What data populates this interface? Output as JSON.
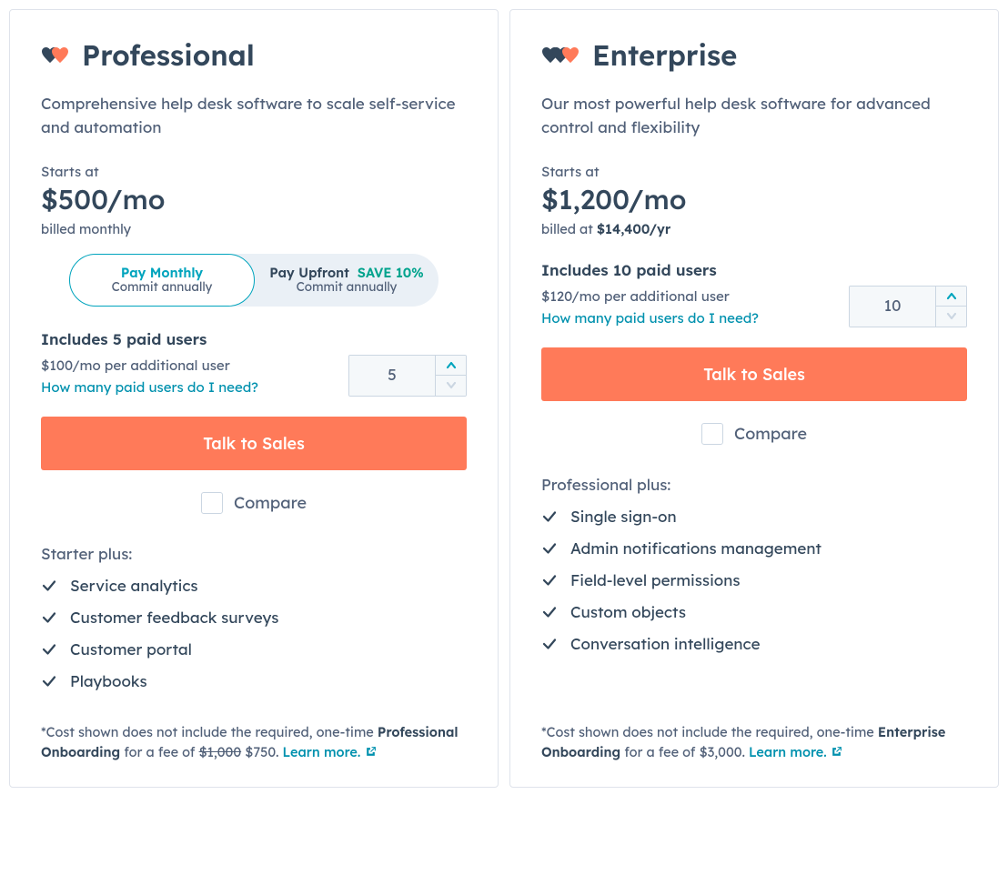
{
  "plans": [
    {
      "title": "Professional",
      "hearts": 2,
      "description": "Comprehensive help desk software to scale self-service and automation",
      "starts_at_label": "Starts at",
      "price": "$500/mo",
      "billed": "billed monthly",
      "billed_bold": "",
      "toggle": {
        "opt1_line1": "Pay Monthly",
        "opt1_line2": "Commit annually",
        "opt2_line1_a": "Pay Upfront",
        "opt2_line1_b": "SAVE 10%",
        "opt2_line2": "Commit annually"
      },
      "includes": "Includes 5 paid users",
      "per_user": "$100/mo per additional user",
      "how_link": "How many paid users do I need?",
      "stepper_value": "5",
      "cta": "Talk to Sales",
      "compare": "Compare",
      "feat_head": "Starter plus:",
      "features": [
        "Service analytics",
        "Customer feedback surveys",
        "Customer portal",
        "Playbooks"
      ],
      "onboard_prefix": "*Cost shown does not include the required, one-time ",
      "onboard_bold": "Professional Onboarding",
      "onboard_mid": " for a fee of ",
      "onboard_strike": "$1,000",
      "onboard_price": " $750. ",
      "learn": "Learn more."
    },
    {
      "title": "Enterprise",
      "hearts": 3,
      "description": "Our most powerful help desk software for advanced control and flexibility",
      "starts_at_label": "Starts at",
      "price": "$1,200/mo",
      "billed": "billed at ",
      "billed_bold": "$14,400/yr",
      "toggle": null,
      "includes": "Includes 10 paid users",
      "per_user": "$120/mo per additional user",
      "how_link": "How many paid users do I need?",
      "stepper_value": "10",
      "cta": "Talk to Sales",
      "compare": "Compare",
      "feat_head": "Professional plus:",
      "features": [
        "Single sign-on",
        "Admin notifications management",
        "Field-level permissions",
        "Custom objects",
        "Conversation intelligence"
      ],
      "onboard_prefix": "*Cost shown does not include the required, one-time ",
      "onboard_bold": "Enterprise Onboarding",
      "onboard_mid": " for a fee of ",
      "onboard_strike": "",
      "onboard_price": "$3,000. ",
      "learn": "Learn more."
    }
  ]
}
